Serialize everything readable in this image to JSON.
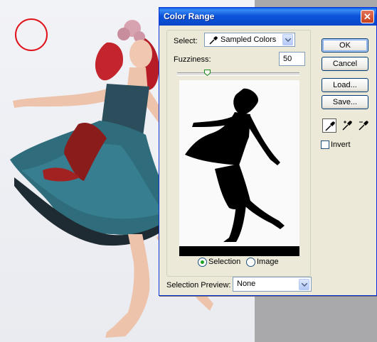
{
  "dialog": {
    "title": "Color Range",
    "close_glyph": "✕",
    "select": {
      "label": "Select:",
      "value": "Sampled Colors",
      "icon": "eyedropper-icon"
    },
    "fuzziness": {
      "label": "Fuzziness:",
      "value": "50",
      "slider_fraction": 0.25
    },
    "preview_mode": {
      "options": [
        "Selection",
        "Image"
      ],
      "selected": "Selection"
    },
    "selection_preview": {
      "label": "Selection Preview:",
      "value": "None"
    },
    "buttons": {
      "ok": "OK",
      "cancel": "Cancel",
      "load": "Load...",
      "save": "Save..."
    },
    "tools": [
      "eyedropper-icon",
      "eyedropper-plus-icon",
      "eyedropper-minus-icon"
    ],
    "invert": {
      "label": "Invert",
      "checked": false
    }
  },
  "colors": {
    "titlebar": "#0c54da",
    "dialog_bg": "#ece9d8",
    "brush_cursor": "#e0121b",
    "canvas_gray": "#a9a9ab"
  }
}
